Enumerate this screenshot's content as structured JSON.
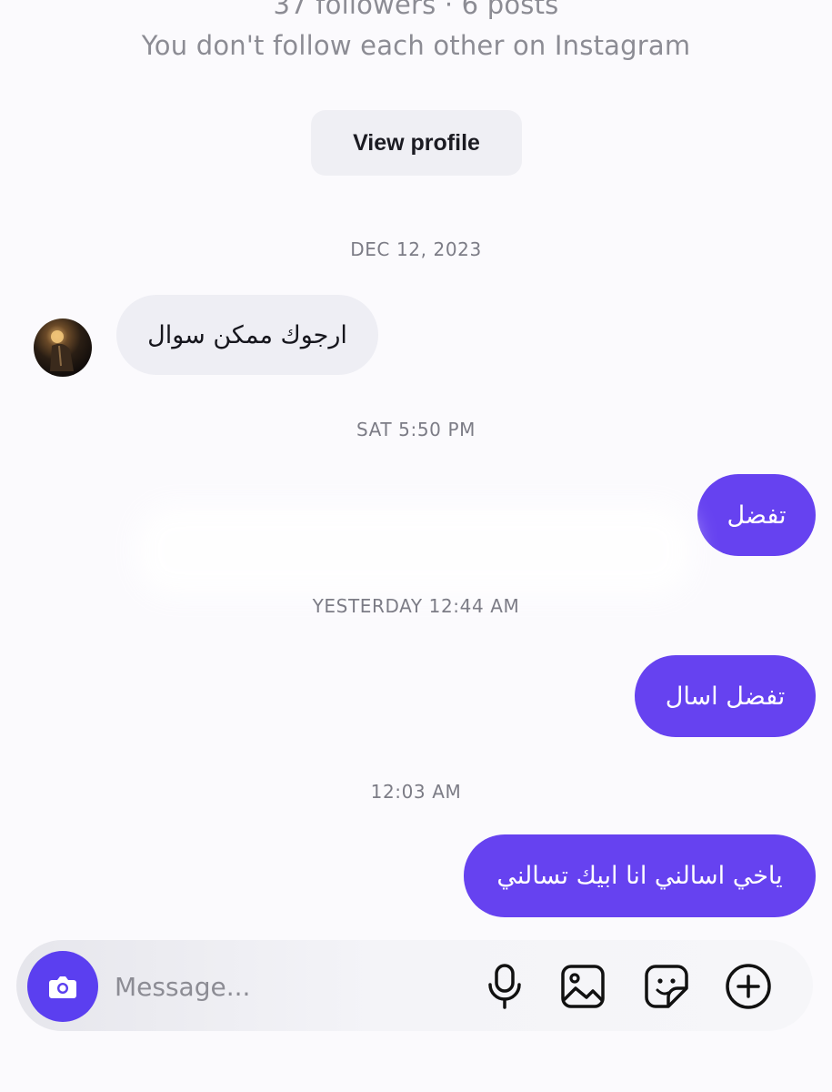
{
  "profile": {
    "stats": "37 followers · 6 posts",
    "follow_note": "You don't follow each other on Instagram",
    "view_profile_label": "View profile"
  },
  "thread": {
    "timestamps": [
      "DEC 12, 2023",
      "SAT 5:50 PM",
      "YESTERDAY 12:44 AM",
      "12:03 AM"
    ],
    "messages": [
      {
        "direction": "incoming",
        "text": "ارجوك ممكن سوال"
      },
      {
        "direction": "outgoing",
        "text": "تفضل"
      },
      {
        "direction": "outgoing",
        "text": "تفضل اسال"
      },
      {
        "direction": "outgoing",
        "text": "ياخي اسالني انا ابيك تسالني"
      }
    ]
  },
  "composer": {
    "placeholder": "Message...",
    "icons": [
      "camera-icon",
      "microphone-icon",
      "gallery-icon",
      "sticker-icon",
      "plus-icon"
    ]
  },
  "colors": {
    "background": "#fbfafd",
    "outgoing_bubble": "#6642f0",
    "incoming_bubble": "#eeeef4",
    "camera_button": "#5b3ff0",
    "secondary_text": "#8c8c94"
  }
}
